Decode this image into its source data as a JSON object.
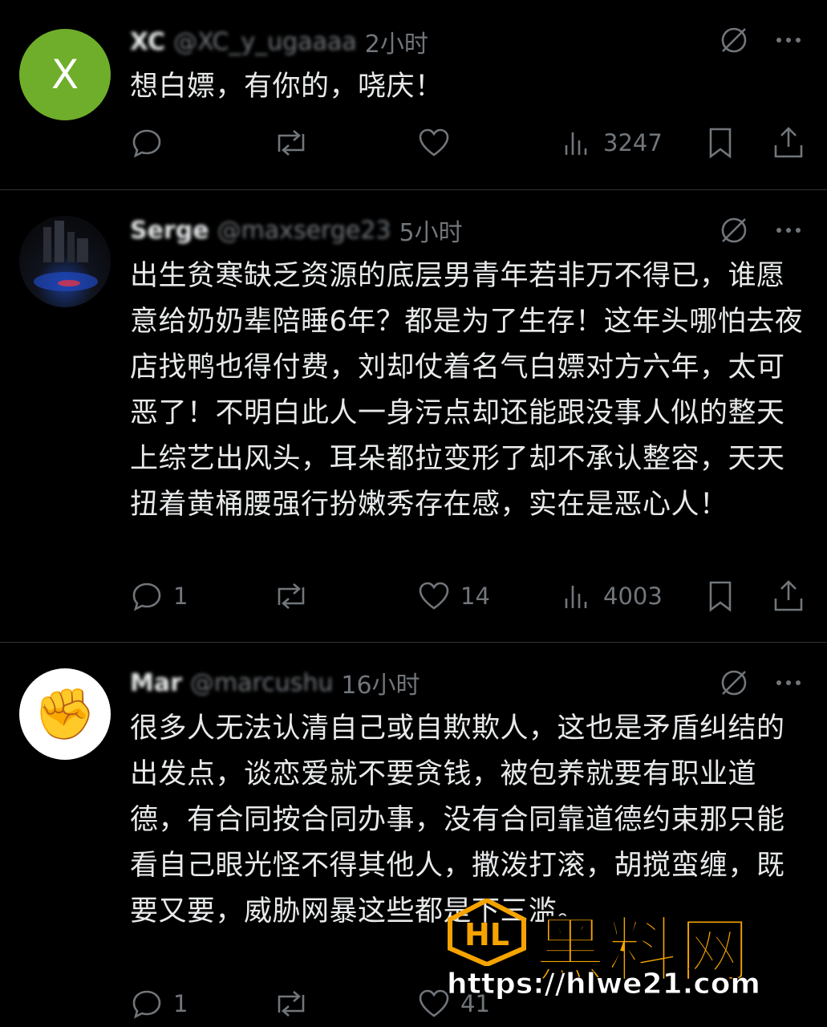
{
  "posts": [
    {
      "avatar_letter": "X",
      "name": "XC",
      "handle": "@XC_y_ugaaaa",
      "time": "2小时",
      "text": "想白嫖，有你的，哓庆！",
      "replies": "",
      "retweets": "",
      "likes": "",
      "views": "3247"
    },
    {
      "name": "Serge",
      "handle": "@maxserge23",
      "time": "5小时",
      "text": "出生贫寒缺乏资源的底层男青年若非万不得已，谁愿意给奶奶辈陪睡6年？都是为了生存！这年头哪怕去夜店找鸭也得付费，刘却仗着名气白嫖对方六年，太可恶了！不明白此人一身污点却还能跟没事人似的整天上综艺出风头，耳朵都拉变形了却不承认整容，天天扭着黄桶腰强行扮嫩秀存在感，实在是恶心人！",
      "replies": "1",
      "retweets": "",
      "likes": "14",
      "views": "4003"
    },
    {
      "avatar_emoji": "✊",
      "name": "Mar",
      "handle": "@marcushu",
      "time": "16小时",
      "text": "很多人无法认清自己或自欺欺人，这也是矛盾纠结的出发点，谈恋爱就不要贪钱，被包养就要有职业道德，有合同按合同办事，没有合同靠道德约束那只能看自己眼光怪不得其他人，撒泼打滚，胡搅蛮缠，既要又要，威胁网暴这些都是下三滥。",
      "replies": "1",
      "retweets": "",
      "likes": "41",
      "views": ""
    }
  ],
  "watermark": {
    "title": "黑料网",
    "url": "https://hlwe21.com"
  },
  "icons": {
    "grok": "grok-icon",
    "more": "more-icon",
    "reply": "reply-icon",
    "retweet": "retweet-icon",
    "like": "like-icon",
    "views": "views-icon",
    "bookmark": "bookmark-icon",
    "share": "share-icon"
  },
  "colors": {
    "background": "#000000",
    "text": "#e7e9ea",
    "muted": "#71767b",
    "avatar_green": "#6fae2b",
    "watermark": "#f5a300"
  }
}
